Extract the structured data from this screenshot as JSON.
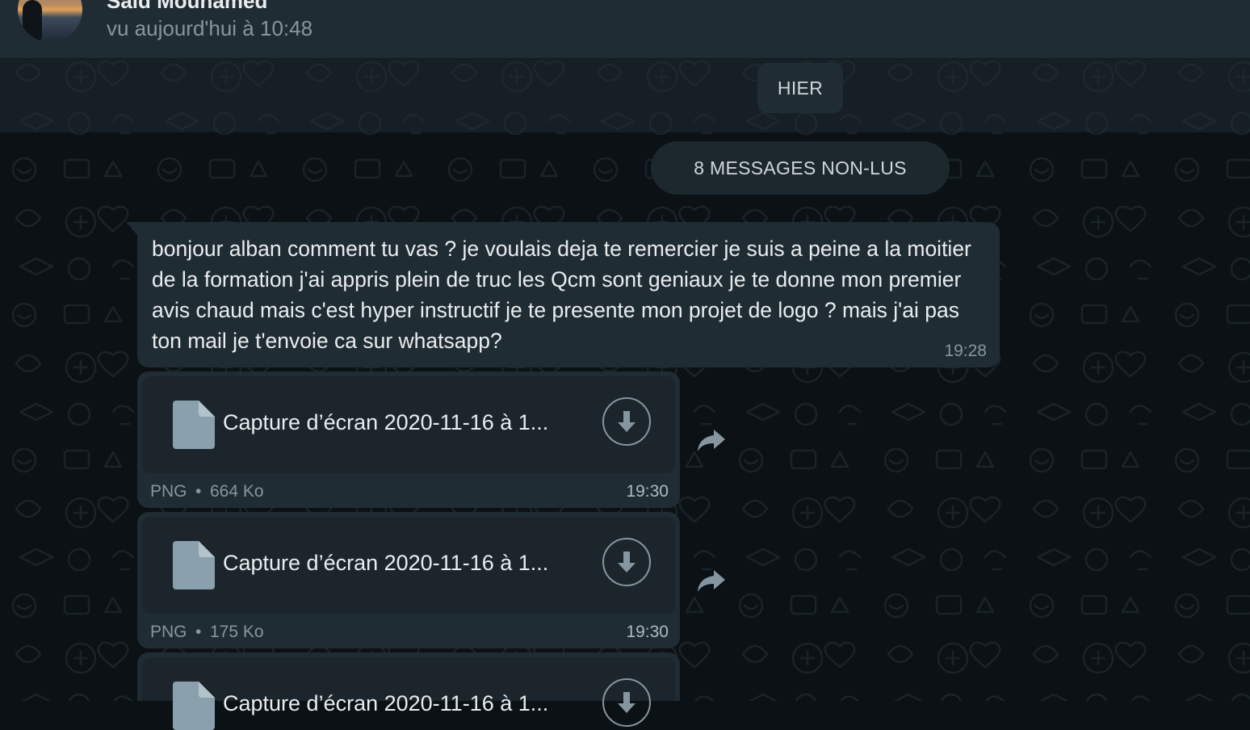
{
  "header": {
    "contact_name": "Said Mouhamed",
    "last_seen": "vu aujourd'hui à 10:48"
  },
  "date_chip": "HIER",
  "unread_chip": "8 MESSAGES NON-LUS",
  "text_message": {
    "text": "bonjour alban comment tu vas ? je voulais deja te remercier je suis a peine a la moitier de la formation j'ai appris plein de truc les Qcm sont geniaux je te donne mon premier avis chaud mais c'est hyper instructif je te presente mon projet de logo ? mais j'ai pas ton mail je t'envoie ca sur whatsapp?",
    "time": "19:28"
  },
  "file_messages": [
    {
      "name": "Capture d’écran 2020-11-16 à 1...",
      "type": "PNG",
      "separator": "•",
      "size": "664 Ko",
      "time": "19:30"
    },
    {
      "name": "Capture d’écran 2020-11-16 à 1...",
      "type": "PNG",
      "separator": "•",
      "size": "175 Ko",
      "time": "19:30"
    },
    {
      "name": "Capture d’écran 2020-11-16 à 1...",
      "type": "",
      "separator": "",
      "size": "",
      "time": ""
    }
  ],
  "colors": {
    "background": "#0b1115",
    "header": "#202c33",
    "bubble": "#202c33",
    "secondary_text": "#8696a0"
  },
  "icons": {
    "file": "document-icon",
    "download": "download-arrow-icon",
    "forward": "forward-icon"
  }
}
